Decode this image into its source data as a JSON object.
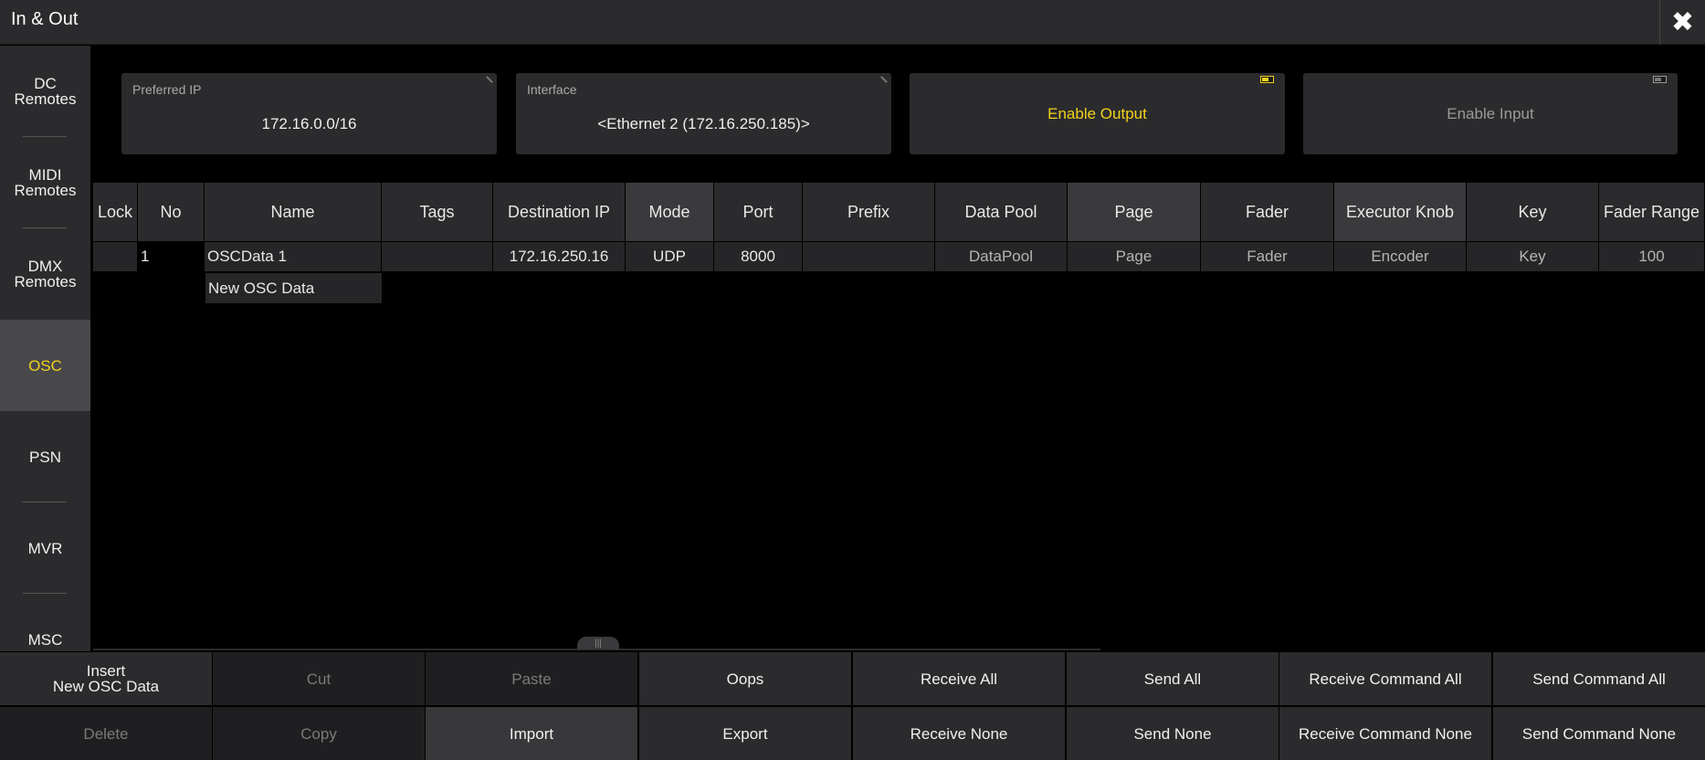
{
  "window": {
    "title": "In & Out",
    "close_icon": "✖"
  },
  "sidebar": {
    "items": [
      {
        "label": "DC\nRemotes"
      },
      {
        "label": "MIDI\nRemotes"
      },
      {
        "label": "DMX\nRemotes"
      },
      {
        "label": "OSC"
      },
      {
        "label": "PSN"
      },
      {
        "label": "MVR"
      },
      {
        "label": "MSC"
      }
    ],
    "active_index": 3
  },
  "controls": {
    "preferred_ip": {
      "label": "Preferred IP",
      "value": "172.16.0.0/16"
    },
    "interface": {
      "label": "Interface",
      "value": "<Ethernet 2 (172.16.250.185)>"
    },
    "enable_output": {
      "label": "Enable Output",
      "enabled": true
    },
    "enable_input": {
      "label": "Enable Input",
      "enabled": false
    }
  },
  "table": {
    "columns": [
      "Lock",
      "No",
      "Name",
      "Tags",
      "Destination IP",
      "Mode",
      "Port",
      "Prefix",
      "Data Pool",
      "Page",
      "Fader",
      "Executor Knob",
      "Key",
      "Fader Range"
    ],
    "rows": [
      {
        "lock": "",
        "no": "1",
        "name": "OSCData 1",
        "tags": "",
        "destination_ip": "172.16.250.16",
        "mode": "UDP",
        "port": "8000",
        "prefix": "",
        "data_pool": "DataPool",
        "page": "Page",
        "fader": "Fader",
        "executor_knob": "Encoder",
        "key": "Key",
        "fader_range": "100"
      }
    ],
    "new_row_label": "New OSC Data"
  },
  "buttons": {
    "row1": [
      "Insert\nNew OSC Data",
      "Cut",
      "Paste",
      "Oops",
      "Receive All",
      "Send All",
      "Receive Command All",
      "Send Command All"
    ],
    "row2": [
      "Delete",
      "Copy",
      "Import",
      "Export",
      "Receive None",
      "Send None",
      "Receive Command None",
      "Send Command None"
    ]
  },
  "colors": {
    "accent": "#f2d21a",
    "panel": "#2b2b2d",
    "background": "#000000"
  }
}
